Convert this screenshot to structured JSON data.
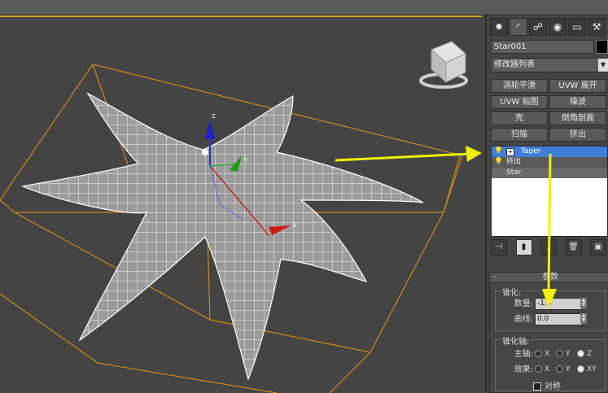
{
  "viewport": {
    "gizmo_axes": {
      "z": "Z",
      "y": "Y",
      "x": "X"
    }
  },
  "command_panel": {
    "tabs": [
      {
        "icon": "create-icon",
        "glyph": "✸"
      },
      {
        "icon": "modify-icon",
        "glyph": "◜"
      },
      {
        "icon": "hierarchy-icon",
        "glyph": "☍"
      },
      {
        "icon": "motion-icon",
        "glyph": "◉"
      },
      {
        "icon": "display-icon",
        "glyph": "▭"
      },
      {
        "icon": "utilities-icon",
        "glyph": "⚒"
      }
    ],
    "object_name": "Star001",
    "object_color": "#000000",
    "modifier_list_label": "修改器列表",
    "modifier_buttons": [
      "涡轮平滑",
      "UVW 展开",
      "UVW 贴图",
      "噪波",
      "壳",
      "倒角剖面",
      "扫描",
      "挤出"
    ],
    "stack": [
      {
        "label": "Taper",
        "selected": true,
        "has_plus": true
      },
      {
        "label": "挤出",
        "selected": false,
        "has_plus": false
      },
      {
        "label": "Star",
        "selected": false,
        "base": true
      }
    ],
    "stack_tools": [
      "pin-stack-icon",
      "show-end-result-icon",
      "make-unique-icon",
      "remove-modifier-icon",
      "configure-sets-icon"
    ]
  },
  "parameters": {
    "rollout_title": "参数",
    "taper_group": "锥化:",
    "amount_label": "数量:",
    "amount_value": "-1.0",
    "curve_label": "曲线:",
    "curve_value": "0.0",
    "axis_group": "锥化轴:",
    "primary_label": "主轴:",
    "primary_options": [
      "X",
      "Y",
      "Z"
    ],
    "primary_selected": "Z",
    "effect_label": "效果:",
    "effect_options": [
      "X",
      "Y",
      "XY"
    ],
    "effect_selected": "XY",
    "symmetry_label": "对称"
  },
  "colors": {
    "selection_blue": "#3f7fd6",
    "viewport_frame": "#d4a21a",
    "annotation_arrow": "#f0f000"
  }
}
